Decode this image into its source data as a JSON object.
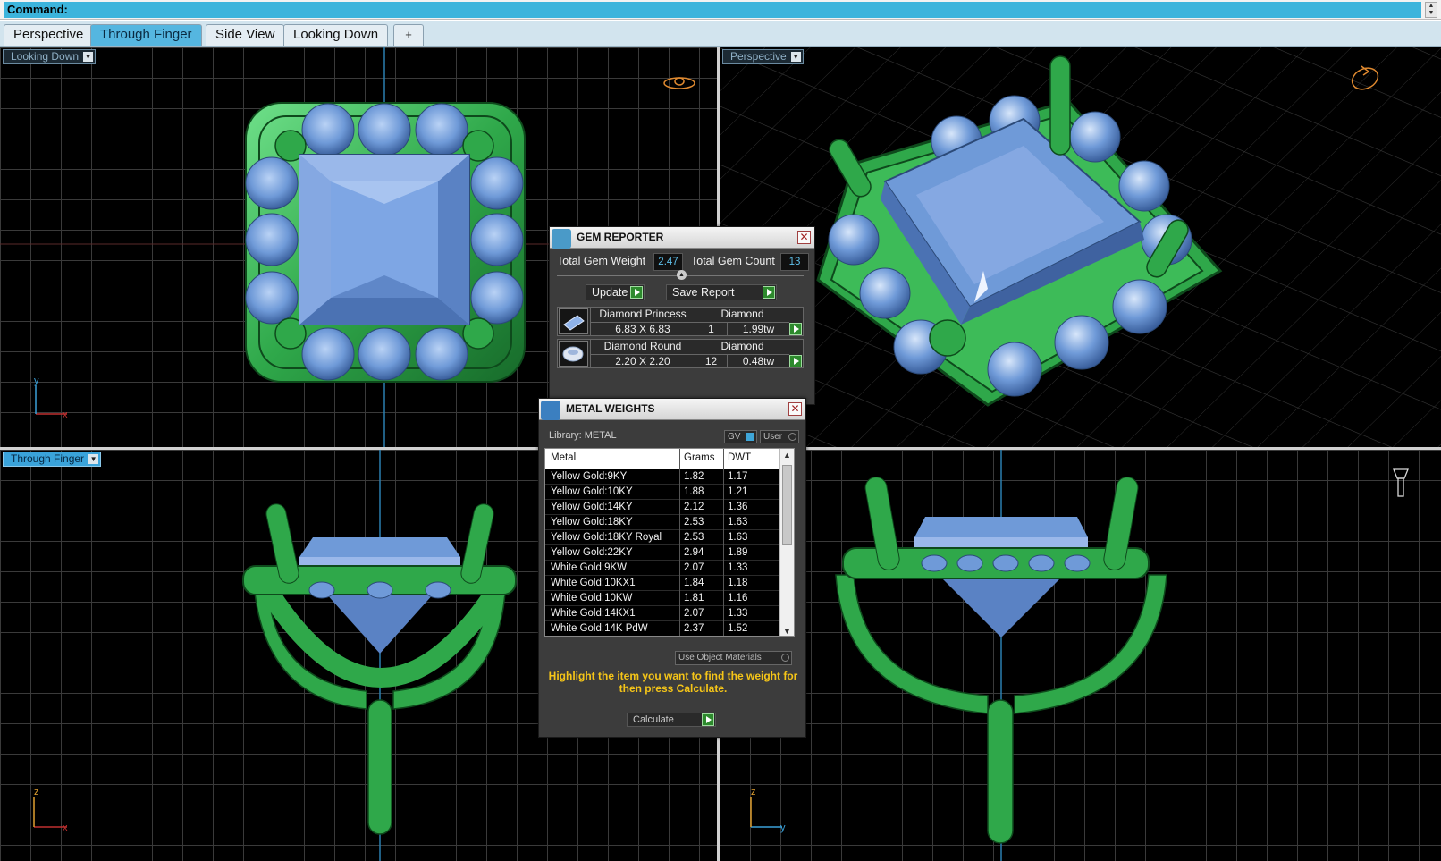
{
  "command_bar": {
    "label": "Command:"
  },
  "tabs": [
    {
      "label": "Perspective",
      "active": false
    },
    {
      "label": "Through Finger",
      "active": true
    },
    {
      "label": "Side View",
      "active": false
    },
    {
      "label": "Looking Down",
      "active": false
    }
  ],
  "tab_add_symbol": "+",
  "viewports": {
    "top_left": {
      "label": "Looking Down",
      "active": false
    },
    "top_right": {
      "label": "Perspective",
      "active": false
    },
    "bottom_left": {
      "label": "Through Finger",
      "active": true
    },
    "bottom_right": {
      "label": ""
    }
  },
  "axes": {
    "top_left": {
      "v": "y",
      "h": "x"
    },
    "bottom_left": {
      "v": "z",
      "h": "x"
    },
    "bottom_right": {
      "v": "z",
      "h": "y"
    }
  },
  "gem_reporter": {
    "title": "GEM REPORTER",
    "total_weight_label": "Total Gem Weight",
    "total_weight_value": "2.47",
    "total_count_label": "Total Gem Count",
    "total_count_value": "13",
    "update_label": "Update",
    "save_report_label": "Save Report",
    "gems": [
      {
        "name": "Diamond Princess",
        "material": "Diamond",
        "size": "6.83 X 6.83",
        "count": "1",
        "weight": "1.99tw"
      },
      {
        "name": "Diamond Round",
        "material": "Diamond",
        "size": "2.20 X 2.20",
        "count": "12",
        "weight": "0.48tw"
      }
    ]
  },
  "metal_weights": {
    "title": "METAL WEIGHTS",
    "library_label": "Library: METAL",
    "gv_label": "GV",
    "user_label": "User",
    "columns": [
      "Metal",
      "Grams",
      "DWT"
    ],
    "rows": [
      {
        "metal": "Yellow Gold:9KY",
        "grams": "1.82",
        "dwt": "1.17"
      },
      {
        "metal": "Yellow Gold:10KY",
        "grams": "1.88",
        "dwt": "1.21"
      },
      {
        "metal": "Yellow Gold:14KY",
        "grams": "2.12",
        "dwt": "1.36"
      },
      {
        "metal": "Yellow Gold:18KY",
        "grams": "2.53",
        "dwt": "1.63"
      },
      {
        "metal": "Yellow Gold:18KY Royal",
        "grams": "2.53",
        "dwt": "1.63"
      },
      {
        "metal": "Yellow Gold:22KY",
        "grams": "2.94",
        "dwt": "1.89"
      },
      {
        "metal": "White Gold:9KW",
        "grams": "2.07",
        "dwt": "1.33"
      },
      {
        "metal": "White Gold:10KX1",
        "grams": "1.84",
        "dwt": "1.18"
      },
      {
        "metal": "White Gold:10KW",
        "grams": "1.81",
        "dwt": "1.16"
      },
      {
        "metal": "White Gold:14KX1",
        "grams": "2.07",
        "dwt": "1.33"
      },
      {
        "metal": "White Gold:14K PdW",
        "grams": "2.37",
        "dwt": "1.52"
      }
    ],
    "use_object_materials_label": "Use Object Materials",
    "hint": "Highlight the item you want to find the weight for then press Calculate.",
    "calculate_label": "Calculate"
  },
  "colors": {
    "command_bg": "#3cb4dc",
    "active_tab": "#55b6e0",
    "viewport_bg": "#000000",
    "grid": "#3a3a3a",
    "metal_green": "#2fa84a",
    "gem_blue": "#6f9ad8",
    "hint_yellow": "#f5c518",
    "value_blue": "#5fc0ea"
  }
}
